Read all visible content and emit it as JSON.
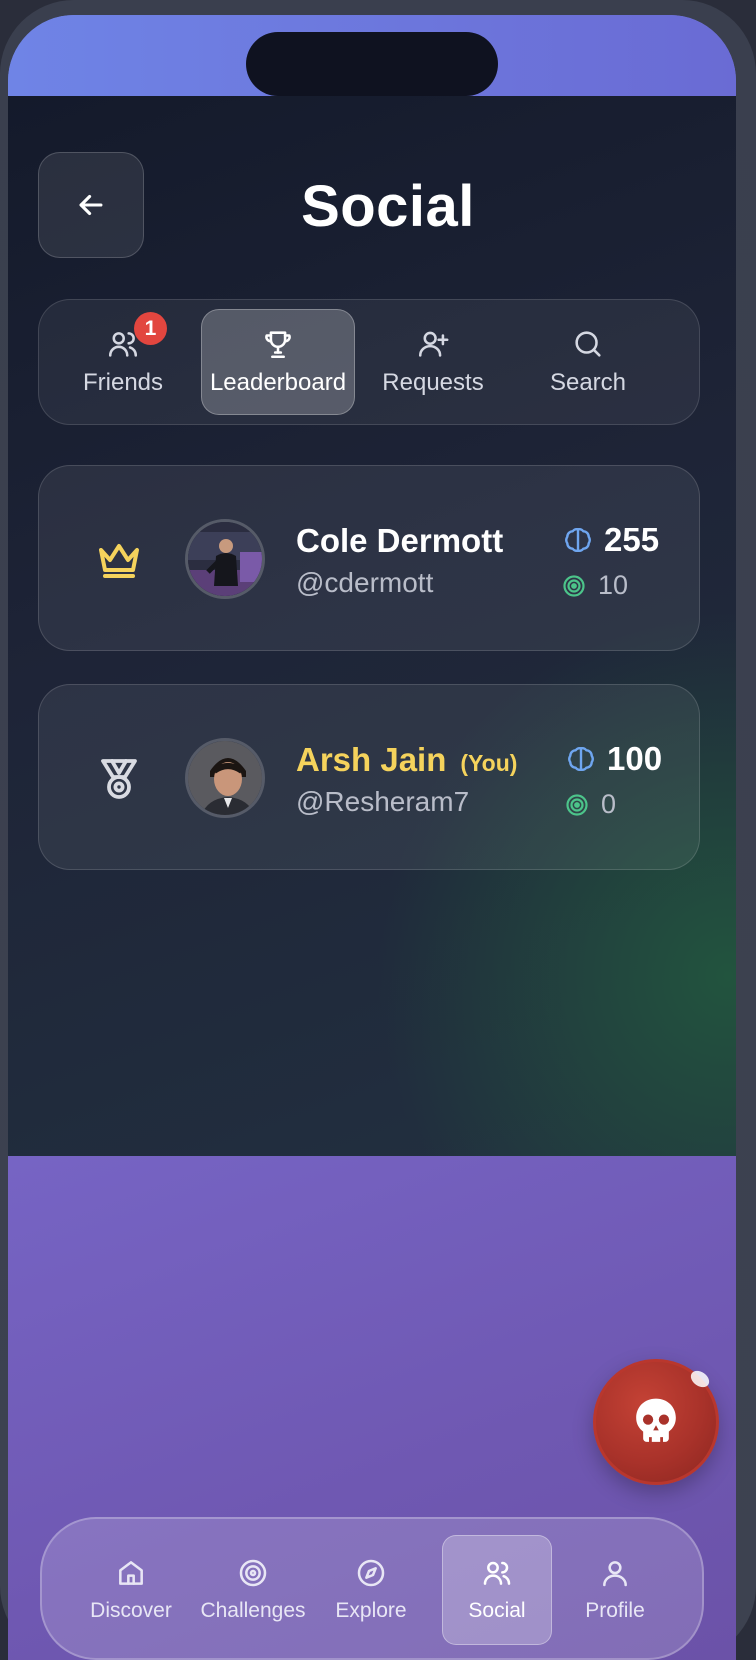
{
  "header": {
    "title": "Social",
    "back_icon": "arrow-left-icon"
  },
  "tabs": [
    {
      "label": "Friends",
      "icon": "users-icon",
      "badge": "1",
      "active": false
    },
    {
      "label": "Leaderboard",
      "icon": "trophy-icon",
      "active": true
    },
    {
      "label": "Requests",
      "icon": "user-plus-icon",
      "active": false
    },
    {
      "label": "Search",
      "icon": "search-icon",
      "active": false
    }
  ],
  "leaderboard": [
    {
      "rank_icon": "crown-icon",
      "name": "Cole Dermott",
      "handle": "@cdermott",
      "brain_score": "255",
      "target_score": "10",
      "is_you": false
    },
    {
      "rank_icon": "medal-icon",
      "name": "Arsh Jain",
      "you_label": "(You)",
      "handle": "@Resheram7",
      "brain_score": "100",
      "target_score": "0",
      "is_you": true
    }
  ],
  "fab": {
    "icon": "skull-icon"
  },
  "bottom_nav": [
    {
      "label": "Discover",
      "icon": "home-icon",
      "active": false
    },
    {
      "label": "Challenges",
      "icon": "target-icon",
      "active": false
    },
    {
      "label": "Explore",
      "icon": "compass-icon",
      "active": false
    },
    {
      "label": "Social",
      "icon": "users-icon",
      "active": true
    },
    {
      "label": "Profile",
      "icon": "user-icon",
      "active": false
    }
  ],
  "colors": {
    "highlight_yellow": "#f5d35c",
    "brain_blue": "#6fa6f0",
    "target_green": "#4cc48a",
    "badge_red": "#e2463f",
    "fab_red": "#b9372d"
  }
}
